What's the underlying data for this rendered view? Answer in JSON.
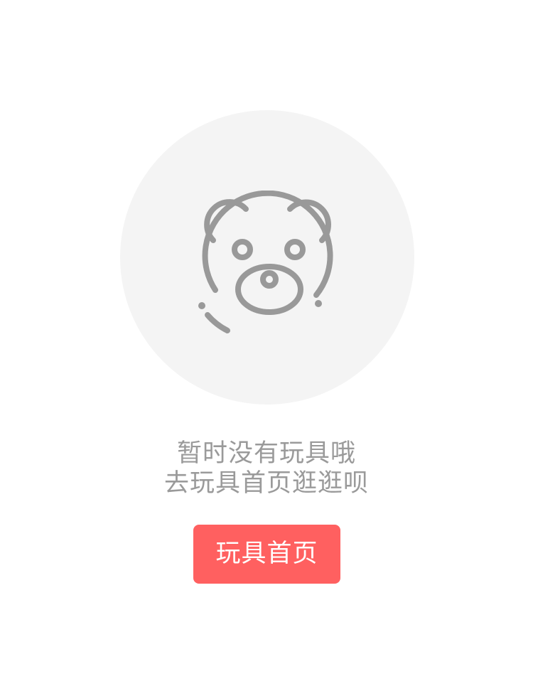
{
  "empty_state": {
    "icon": "teddy-bear-icon",
    "message_line_1": "暂时没有玩具哦",
    "message_line_2": "去玩具首页逛逛呗",
    "button_label": "玩具首页"
  },
  "colors": {
    "background": "#ffffff",
    "circle": "#f4f4f4",
    "icon": "#999999",
    "text": "#9a9a9a",
    "button": "#ff6060",
    "button_text": "#ffffff"
  }
}
